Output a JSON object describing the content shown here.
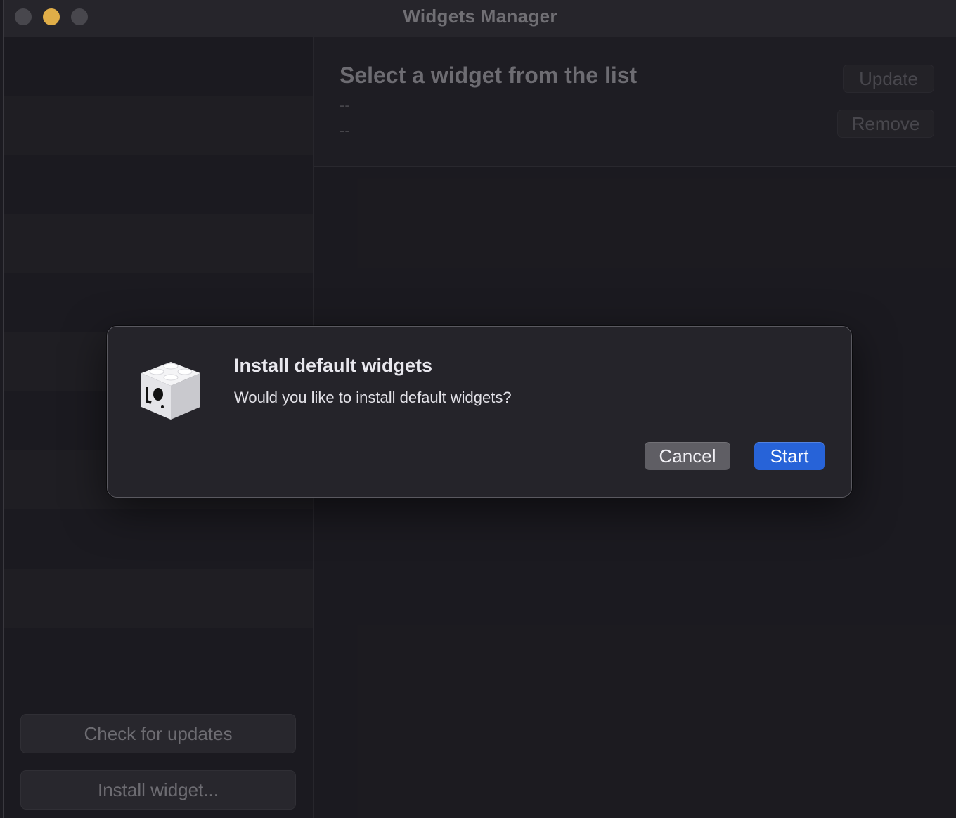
{
  "window": {
    "title": "Widgets Manager"
  },
  "sidebar": {
    "check_updates_label": "Check for updates",
    "install_widget_label": "Install widget..."
  },
  "details": {
    "placeholder_title": "Select a widget from the list",
    "line1": "--",
    "line2": "--",
    "update_label": "Update",
    "remove_label": "Remove"
  },
  "dialog": {
    "title": "Install default widgets",
    "message": "Would you like to install default widgets?",
    "cancel_label": "Cancel",
    "start_label": "Start"
  },
  "colors": {
    "accent": "#2763d8",
    "traffic_minimize": "#f4bd4f"
  }
}
